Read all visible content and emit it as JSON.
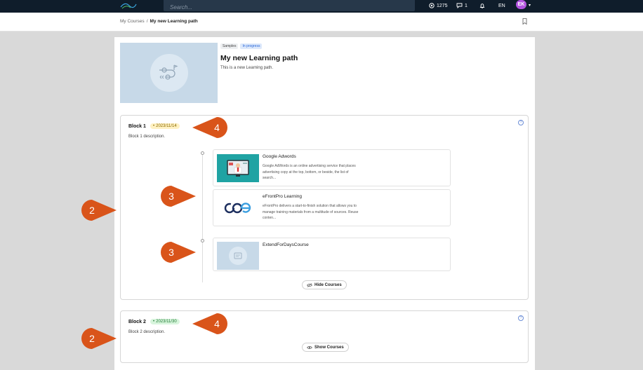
{
  "topbar": {
    "search_placeholder": "Search...",
    "points": "1275",
    "messages": "1",
    "language": "EN",
    "avatar_initials": "EK"
  },
  "breadcrumb": {
    "parent": "My Courses",
    "separator": "/",
    "current": "My new Learning path"
  },
  "learning_path": {
    "tags": [
      "Samples",
      "In progress"
    ],
    "title": "My new Learning path",
    "description": "This is a new Learning path."
  },
  "blocks": [
    {
      "title": "Block 1",
      "date": "2023/11/14",
      "date_color": "yellow",
      "description": "Block 1 description.",
      "courses": [
        {
          "title": "Google Adwords",
          "description": "Google AdWords is an online advertising service that places advertising copy at the top, bottom, or beside, the list of search..."
        },
        {
          "title": "eFrontPro Learning",
          "description": "eFrontPro delivers a start-to-finish solution that allows you to manage training materials from a multitude of sources. Reuse conten..."
        },
        {
          "title": "ExtendForDaysCourse",
          "description": ""
        }
      ],
      "toggle_label": "Hide Courses"
    },
    {
      "title": "Block 2",
      "date": "2023/11/30",
      "date_color": "green",
      "description": "Block 2 description.",
      "toggle_label": "Show Courses"
    }
  ],
  "callouts": {
    "block_marker": "2",
    "course_marker": "3",
    "date_marker": "4"
  },
  "colors": {
    "topbar": "#0f1d2b",
    "callout": "#d9541a",
    "avatar": "#b455e0",
    "tag_blue": "#2b68d9"
  }
}
